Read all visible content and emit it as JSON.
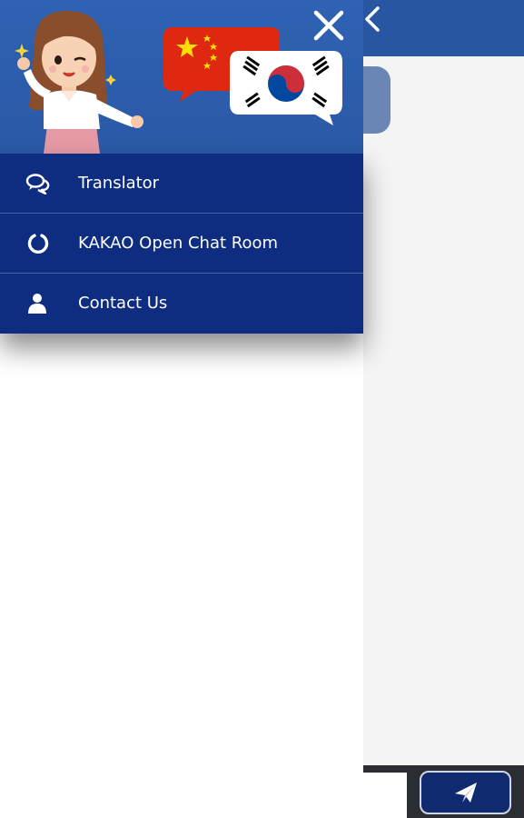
{
  "app": {
    "colors": {
      "header": "#2956a3",
      "drawer_menu": "#0e2d80",
      "body": "#f4f4f4",
      "send_button": "#0f2a6e"
    }
  },
  "drawer": {
    "header_art": [
      "girl-illustration",
      "china-flag-bubble",
      "korea-flag-bubble"
    ],
    "menu": [
      {
        "label": "Translator",
        "icon": "chat-bubbles-icon"
      },
      {
        "label": "KAKAO Open Chat Room",
        "icon": "open-chat-ring-icon"
      },
      {
        "label": "Contact Us",
        "icon": "person-icon"
      }
    ]
  },
  "chat": {
    "input_value": "",
    "send_icon": "paper-plane-icon"
  }
}
